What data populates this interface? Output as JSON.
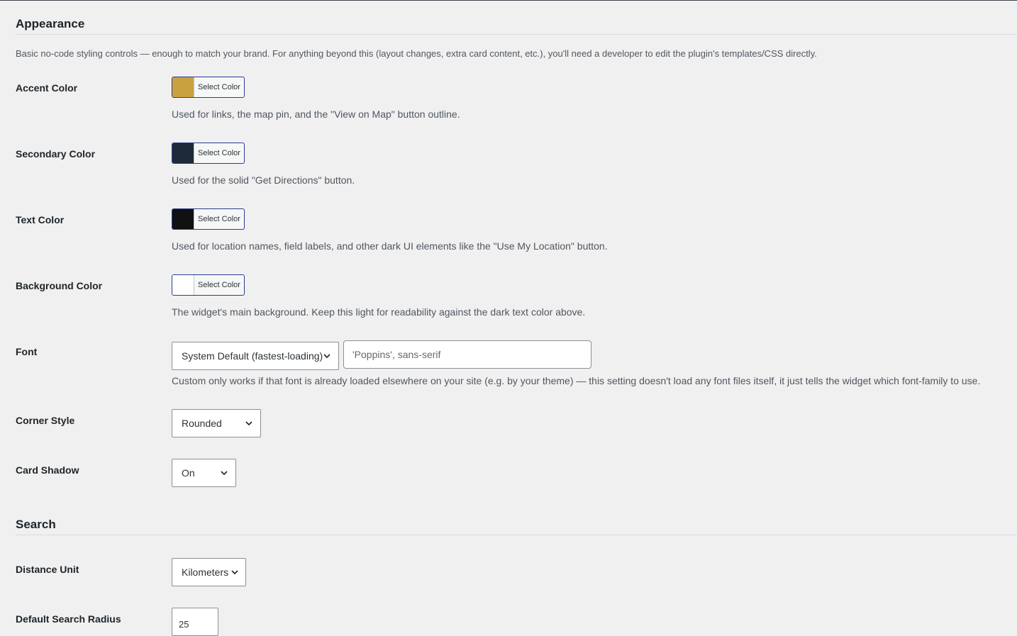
{
  "appearance": {
    "title": "Appearance",
    "intro": "Basic no-code styling controls — enough to match your brand. For anything beyond this (layout changes, extra card content, etc.), you'll need a developer to edit the plugin's templates/CSS directly."
  },
  "accent": {
    "label": "Accent Color",
    "button": "Select Color",
    "color": "#c9a13f",
    "desc": "Used for links, the map pin, and the \"View on Map\" button outline."
  },
  "secondary": {
    "label": "Secondary Color",
    "button": "Select Color",
    "color": "#1e2a3a",
    "desc": "Used for the solid \"Get Directions\" button."
  },
  "text_color": {
    "label": "Text Color",
    "button": "Select Color",
    "color": "#111111",
    "desc": "Used for location names, field labels, and other dark UI elements like the \"Use My Location\" button."
  },
  "background": {
    "label": "Background Color",
    "button": "Select Color",
    "color": "#ffffff",
    "desc": "The widget's main background. Keep this light for readability against the dark text color above."
  },
  "font": {
    "label": "Font",
    "selected": "System Default (fastest-loading)",
    "custom_placeholder": "'Poppins', sans-serif",
    "desc": "Custom only works if that font is already loaded elsewhere on your site (e.g. by your theme) — this setting doesn't load any font files itself, it just tells the widget which font-family to use."
  },
  "corner": {
    "label": "Corner Style",
    "selected": "Rounded"
  },
  "shadow": {
    "label": "Card Shadow",
    "selected": "On"
  },
  "search": {
    "title": "Search",
    "distance_unit": {
      "label": "Distance Unit",
      "selected": "Kilometers"
    },
    "radius": {
      "label": "Default Search Radius",
      "value": "25"
    }
  },
  "icons": {
    "dropdown": "chevron-down-icon"
  }
}
